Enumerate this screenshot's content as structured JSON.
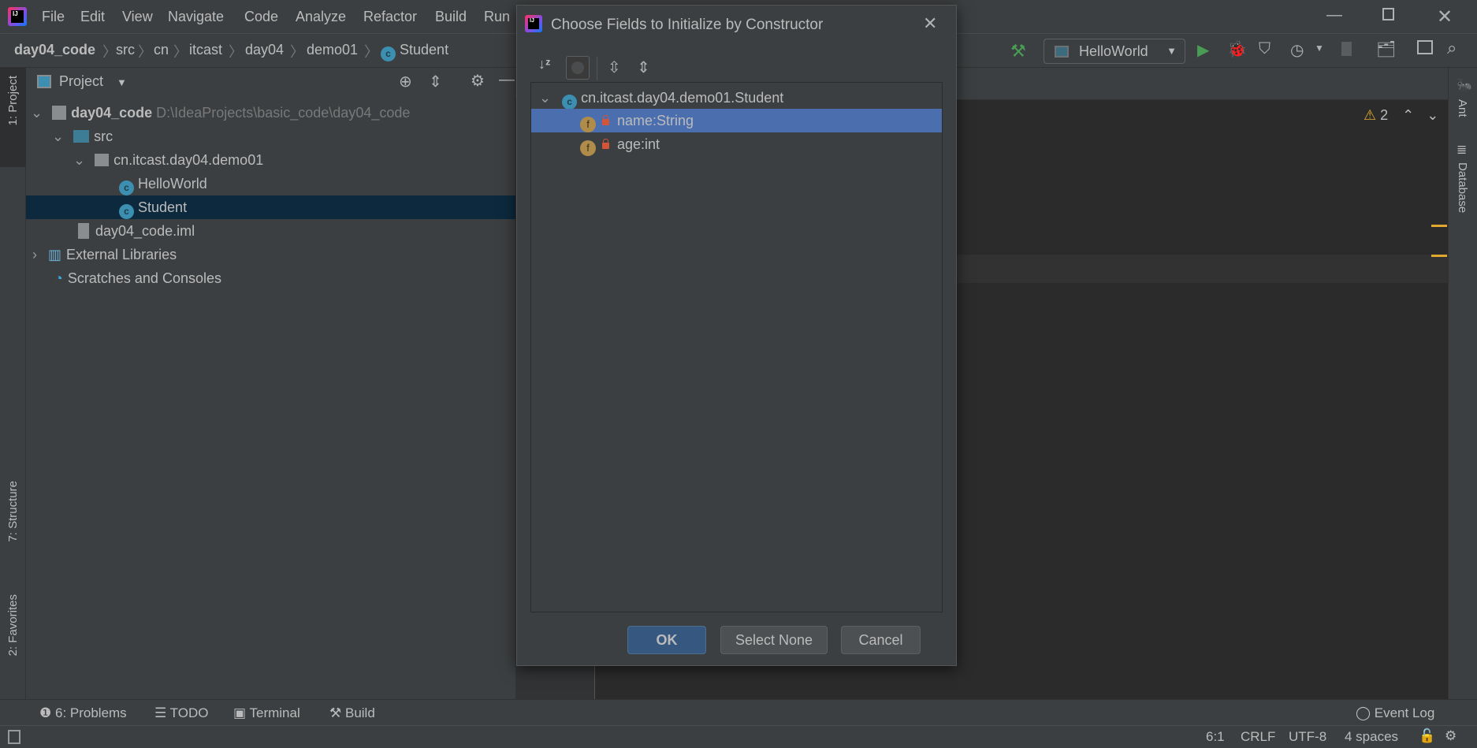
{
  "menu": [
    "File",
    "Edit",
    "View",
    "Navigate",
    "Code",
    "Analyze",
    "Refactor",
    "Build",
    "Run"
  ],
  "breadcrumb": [
    "day04_code",
    "src",
    "cn",
    "itcast",
    "day04",
    "demo01",
    "Student"
  ],
  "run_config": "HelloWorld",
  "project_panel": {
    "title": "Project",
    "tree": [
      {
        "label": "day04_code",
        "extra": "D:\\IdeaProjects\\basic_code\\day04_code"
      },
      {
        "label": "src"
      },
      {
        "label": "cn.itcast.day04.demo01"
      },
      {
        "label": "HelloWorld"
      },
      {
        "label": "Student",
        "selected": true
      },
      {
        "label": "day04_code.iml"
      },
      {
        "label": "External Libraries"
      },
      {
        "label": "Scratches and Consoles"
      }
    ]
  },
  "left_strip": [
    "1: Project",
    "7: Structure",
    "2: Favorites"
  ],
  "right_strip": [
    "Ant",
    "Database"
  ],
  "editor": {
    "warnings": "2"
  },
  "dialog": {
    "title": "Choose Fields to Initialize by Constructor",
    "class_node": "cn.itcast.day04.demo01.Student",
    "fields": [
      {
        "label": "name:String",
        "selected": true
      },
      {
        "label": "age:int",
        "selected": false
      }
    ],
    "ok": "OK",
    "select_none": "Select None",
    "cancel": "Cancel"
  },
  "bottom_tools": [
    "6: Problems",
    "TODO",
    "Terminal",
    "Build"
  ],
  "event_log": "Event Log",
  "status": {
    "position": "6:1",
    "line_sep": "CRLF",
    "encoding": "UTF-8",
    "indent": "4 spaces"
  },
  "colors": {
    "selection": "#4b6eaf",
    "tree_selection": "#0d293e",
    "ok_button": "#365880",
    "accent_green": "#499c54"
  }
}
